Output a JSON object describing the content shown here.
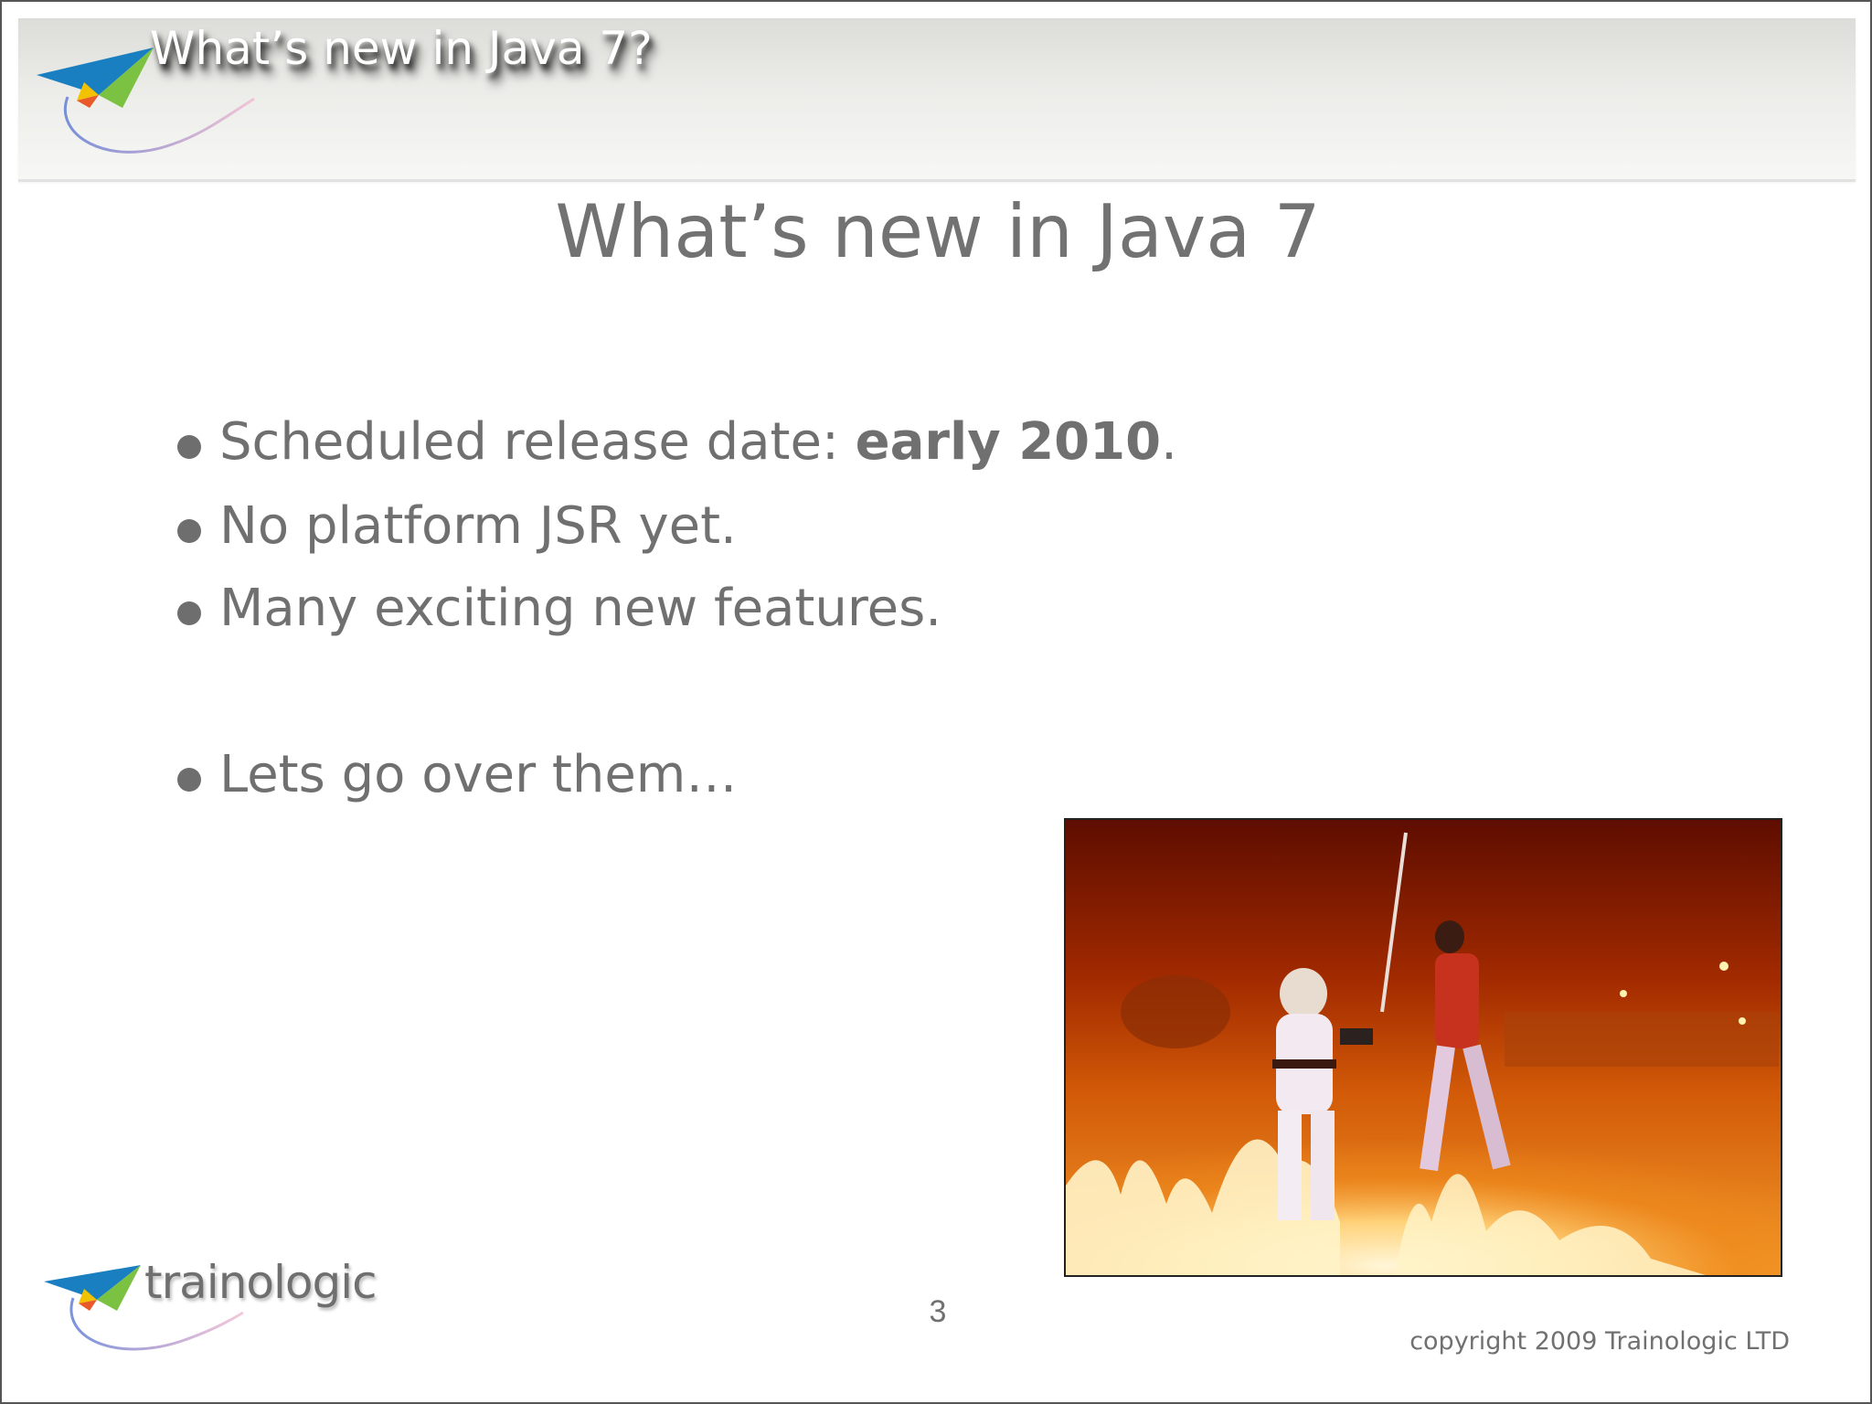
{
  "header": {
    "title": "What’s new in Java 7?"
  },
  "slide": {
    "title": "What’s new in Java 7",
    "bullets": [
      {
        "prefix": "Scheduled release date: ",
        "bold": "early 2010",
        "suffix": "."
      },
      {
        "text": "No platform JSR yet."
      },
      {
        "text": "Many exciting new features."
      },
      {
        "text": "Lets go over them…"
      }
    ],
    "page_number": "3"
  },
  "footer": {
    "logo_text": "trainologic",
    "copyright": "copyright 2009 Trainologic LTD"
  },
  "icons": {
    "header_logo": "paper-plane-icon",
    "footer_logo": "paper-plane-icon",
    "bullet": "bullet-dot-icon"
  },
  "colors": {
    "text": "#707070",
    "header_band": "#e4e4e1",
    "plane_blue": "#1a7fc1",
    "plane_green": "#7cc242",
    "plane_yellow": "#f2c200"
  }
}
